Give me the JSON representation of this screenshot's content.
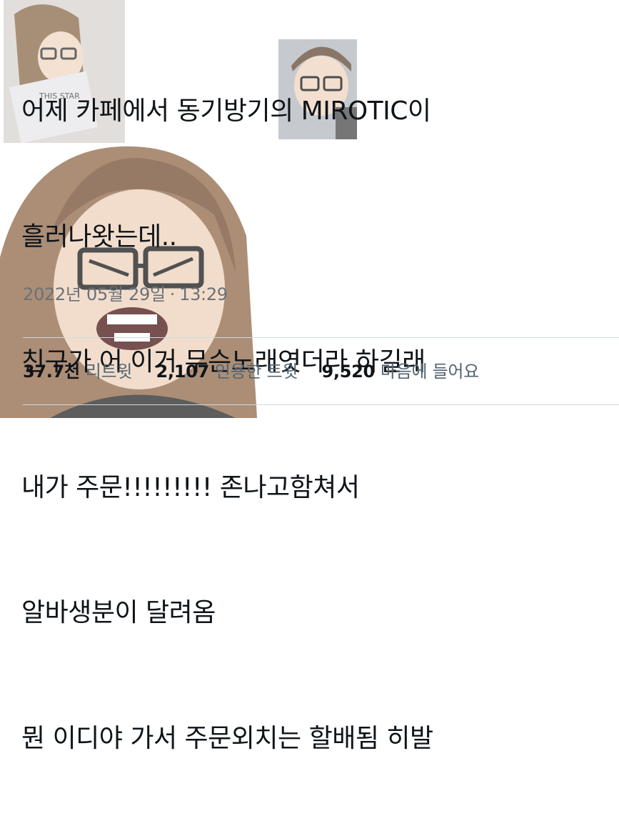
{
  "tweet": {
    "text_lines": [
      "어제 카페에서 동기방기의 MIROTIC이",
      "흘러나왓는데..",
      "친구가 어 이거 무슨노래엿더라 하길래",
      "내가 주문!!!!!!!!! 존나고함쳐서",
      "알바생분이 달려옴",
      "뭔 이디야 가서 주문외치는 할배됨 히발"
    ],
    "date": "2022년 05월 29일",
    "separator": "·",
    "time": "13:29"
  },
  "stats": {
    "retweets": {
      "count": "37.7천",
      "label": "리트윗"
    },
    "quotes": {
      "count": "2,107",
      "label": "인용한 트윗"
    },
    "likes": {
      "count": "9,520",
      "label": "마음에 들어요"
    }
  },
  "colors": {
    "text": "#0f1419",
    "secondary": "#536471",
    "divider": "#cfd9de"
  }
}
